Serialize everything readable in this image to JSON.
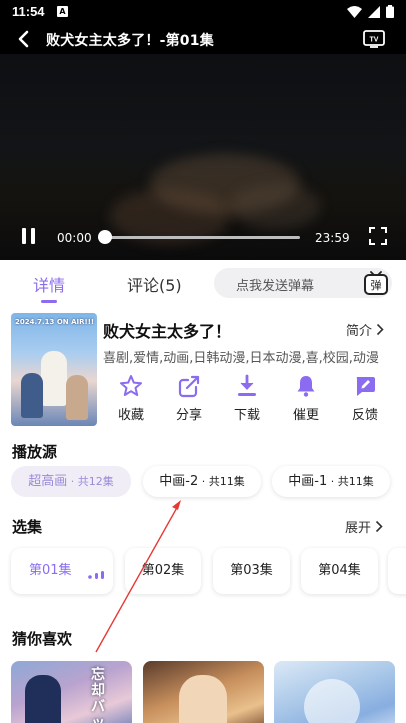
{
  "status_bar": {
    "time": "11:54",
    "notification_icon": "A"
  },
  "header": {
    "title": "败犬女主太多了！-第01集"
  },
  "player": {
    "current_time": "00:00",
    "total_time": "23:59",
    "progress": 0.0
  },
  "tabs": [
    {
      "label": "详情",
      "active": true
    },
    {
      "label": "评论(5)",
      "active": false
    }
  ],
  "danmaku": {
    "placeholder": "点我发送弹幕",
    "icon_label": "弹"
  },
  "anime": {
    "title": "败犬女主太多了！",
    "intro_label": "简介",
    "genres": "喜剧,爱情,动画,日韩动漫,日本动漫,喜,校园,动漫",
    "poster_text": "2024.7.13 ON AIR!!!"
  },
  "actions": [
    {
      "label": "收藏",
      "icon": "star-icon"
    },
    {
      "label": "分享",
      "icon": "share-icon"
    },
    {
      "label": "下载",
      "icon": "download-icon"
    },
    {
      "label": "催更",
      "icon": "bell-icon"
    },
    {
      "label": "反馈",
      "icon": "feedback-icon"
    }
  ],
  "sources": {
    "title": "播放源",
    "items": [
      {
        "name": "超高画",
        "count": " · 共12集",
        "active": true
      },
      {
        "name": "中画-2",
        "count": " · 共11集",
        "active": false
      },
      {
        "name": "中画-1",
        "count": " · 共11集",
        "active": false
      }
    ]
  },
  "episodes": {
    "title": "选集",
    "expand_label": "展开",
    "items": [
      {
        "label": "第01集",
        "active": true
      },
      {
        "label": "第02集",
        "active": false
      },
      {
        "label": "第03集",
        "active": false
      },
      {
        "label": "第04集",
        "active": false
      }
    ]
  },
  "recommend": {
    "title": "猜你喜欢",
    "first_card_text": "忘却バッテ"
  },
  "colors": {
    "accent": "#8b6cf0",
    "arrow": "#e53935",
    "active_pill_bg": "#f0edf7"
  }
}
